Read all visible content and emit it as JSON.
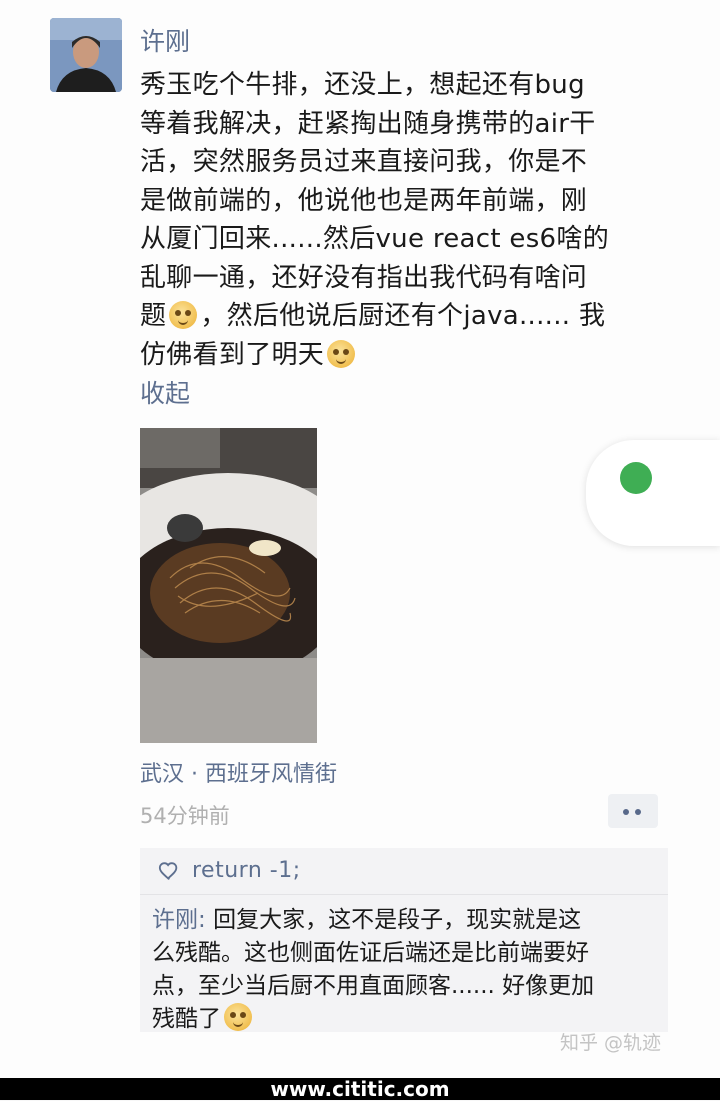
{
  "post": {
    "author": "许刚",
    "text_lines": [
      "秀玉吃个牛排，还没上，想起还有bug",
      "等着我解决，赶紧掏出随身携带的air干",
      "活，突然服务员过来直接问我，你是不",
      "是做前端的，他说他也是两年前端，刚",
      "从厦门回来......然后vue react es6啥的",
      "乱聊一通，还好没有指出我代码有啥问",
      "题",
      "，然后他说后厨还有个java...... 我",
      "仿佛看到了明天"
    ],
    "emojis": [
      "smile-emoji",
      "grin-emoji",
      "grin-emoji"
    ],
    "collapse_label": "收起",
    "location": "武汉 · 西班牙风情街",
    "time": "54分钟前"
  },
  "comments": {
    "likes": "return -1;",
    "reply": {
      "commenter": "许刚",
      "separator": ": ",
      "text_lines": [
        "回复大家，这不是段子，现实就是这",
        "么残酷。这也侧面佐证后端还是比前端要好",
        "点，至少当后厨不用直面顾客...... 好像更加",
        "残酷了"
      ]
    }
  },
  "watermark": "知乎 @轨迹",
  "footer": "www.cititic.com",
  "colors": {
    "link": "#5d6f8f",
    "accent": "#3fae54",
    "muted": "#b0b0b0"
  }
}
